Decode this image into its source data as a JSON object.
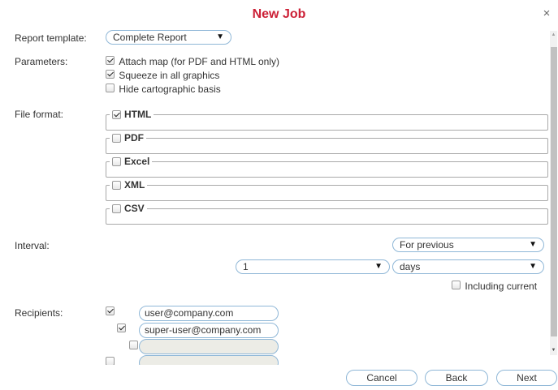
{
  "dialog": {
    "title": "New Job",
    "close_symbol": "×"
  },
  "report_template": {
    "label": "Report template:",
    "value": "Complete Report"
  },
  "parameters": {
    "label": "Parameters:",
    "options": [
      {
        "label": "Attach map (for PDF and HTML only)",
        "checked": true
      },
      {
        "label": "Squeeze in all graphics",
        "checked": true
      },
      {
        "label": "Hide cartographic basis",
        "checked": false
      }
    ]
  },
  "file_format": {
    "label": "File format:",
    "formats": [
      {
        "label": "HTML",
        "checked": true
      },
      {
        "label": "PDF",
        "checked": false
      },
      {
        "label": "Excel",
        "checked": false
      },
      {
        "label": "XML",
        "checked": false
      },
      {
        "label": "CSV",
        "checked": false
      }
    ]
  },
  "interval": {
    "label": "Interval:",
    "mode": "For previous",
    "count": "1",
    "unit": "days",
    "including_current_label": "Including current",
    "including_current": false
  },
  "recipients": {
    "label": "Recipients:",
    "rows": [
      {
        "email": "user@company.com",
        "checked": true
      },
      {
        "email": "super-user@company.com",
        "checked": true
      },
      {
        "email": "",
        "checked": false
      },
      {
        "email": "",
        "checked": false
      }
    ]
  },
  "footer": {
    "cancel": "Cancel",
    "back": "Back",
    "next": "Next"
  },
  "dropdown_arrow": "▼",
  "scrollbar": {
    "up_arrow": "▲",
    "down_arrow": "▼"
  }
}
